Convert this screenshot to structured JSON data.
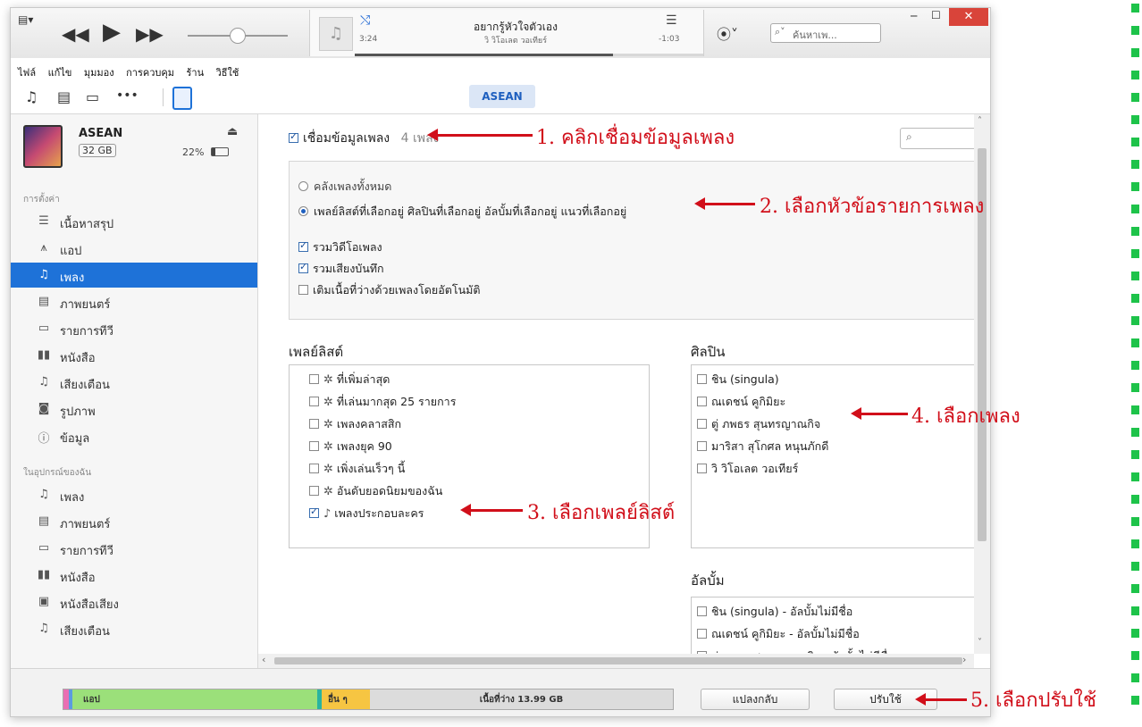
{
  "titlebar": {
    "song_title": "อยากรู้หัวใจตัวเอง",
    "artist": "วิ วิโอเลต วอเทียร์",
    "elapsed": "3:24",
    "remaining": "-1:03",
    "search_placeholder": "ค้นหาเพ..."
  },
  "menubar": {
    "items": [
      "ไฟล์",
      "แก้ไข",
      "มุมมอง",
      "การควบคุม",
      "ร้าน",
      "วิธีใช้"
    ]
  },
  "toolbar": {
    "device_button": "ASEAN"
  },
  "sidebar": {
    "device_name": "ASEAN",
    "capacity": "32 GB",
    "battery": "22%",
    "settings_heading": "การตั้งค่า",
    "settings_items": [
      {
        "label": "เนื้อหาสรุป"
      },
      {
        "label": "แอป"
      },
      {
        "label": "เพลง"
      },
      {
        "label": "ภาพยนตร์"
      },
      {
        "label": "รายการทีวี"
      },
      {
        "label": "หนังสือ"
      },
      {
        "label": "เสียงเตือน"
      },
      {
        "label": "รูปภาพ"
      },
      {
        "label": "ข้อมูล"
      }
    ],
    "device_heading": "ในอุปกรณ์ของฉัน",
    "device_items": [
      {
        "label": "เพลง"
      },
      {
        "label": "ภาพยนตร์"
      },
      {
        "label": "รายการทีวี"
      },
      {
        "label": "หนังสือ"
      },
      {
        "label": "หนังสือเสียง"
      },
      {
        "label": "เสียงเตือน"
      }
    ]
  },
  "main": {
    "sync_label": "เชื่อมข้อมูลเพลง",
    "sync_count": "4 เพลง",
    "radio_all": "คลังเพลงทั้งหมด",
    "radio_selected": "เพลย์ลิสต์ที่เลือกอยู่ ศิลปินที่เลือกอยู่ อัลบั้มที่เลือกอยู่ แนวที่เลือกอยู่",
    "options": [
      {
        "label": "รวมวิดีโอเพลง",
        "checked": true
      },
      {
        "label": "รวมเสียงบันทึก",
        "checked": true
      },
      {
        "label": "เติมเนื้อที่ว่างด้วยเพลงโดยอัตโนมัติ",
        "checked": false
      }
    ],
    "playlists_heading": "เพลย์ลิสต์",
    "playlists": [
      {
        "label": "ที่เพิ่มล่าสุด",
        "checked": false
      },
      {
        "label": "ที่เล่นมากสุด 25 รายการ",
        "checked": false
      },
      {
        "label": "เพลงคลาสสิก",
        "checked": false
      },
      {
        "label": "เพลงยุค 90",
        "checked": false
      },
      {
        "label": "เพิ่งเล่นเร็วๆ นี้",
        "checked": false
      },
      {
        "label": "อันดับยอดนิยมของฉัน",
        "checked": false
      },
      {
        "label": "เพลงประกอบละคร",
        "checked": true
      }
    ],
    "artists_heading": "ศิลปิน",
    "artists": [
      {
        "label": "ชิน (singula)"
      },
      {
        "label": "ณเดชน์ คูกิมิยะ"
      },
      {
        "label": "ตู่ ภพธร สุนทรญาณกิจ"
      },
      {
        "label": "มาริสา สุโกศล หนุนภักดี"
      },
      {
        "label": "วิ วิโอเลต วอเทียร์"
      }
    ],
    "albums_heading": "อัลบั้ม",
    "albums": [
      {
        "label": "ชิน (singula) - อัลบั้มไม่มีชื่อ"
      },
      {
        "label": "ณเดชน์ คูกิมิยะ - อัลบั้มไม่มีชื่อ"
      },
      {
        "label": "ตู่ ภพธร สุนทรญาณกิจ - อัลบั้มไม่มีชื่อ"
      }
    ]
  },
  "bottombar": {
    "apps_label": "แอป",
    "other_label": "อื่น ๆ",
    "free_label": "เนื้อที่ว่าง 13.99 GB",
    "revert_button": "แปลงกลับ",
    "apply_button": "ปรับใช้"
  },
  "annotations": {
    "step1": "1. คลิกเชื่อมข้อมูลเพลง",
    "step2": "2. เลือกหัวข้อรายการเพลง",
    "step3": "3. เลือกเพลย์ลิสต์",
    "step4": "4. เลือกเพลง",
    "step5": "5. เลือกปรับใช้"
  },
  "colors": {
    "selection": "#1e72d8",
    "annotation": "#d10f1a",
    "apps_bar": "#9be07a",
    "other_bar": "#f6c542",
    "deco_squares": "#1ec34a"
  }
}
